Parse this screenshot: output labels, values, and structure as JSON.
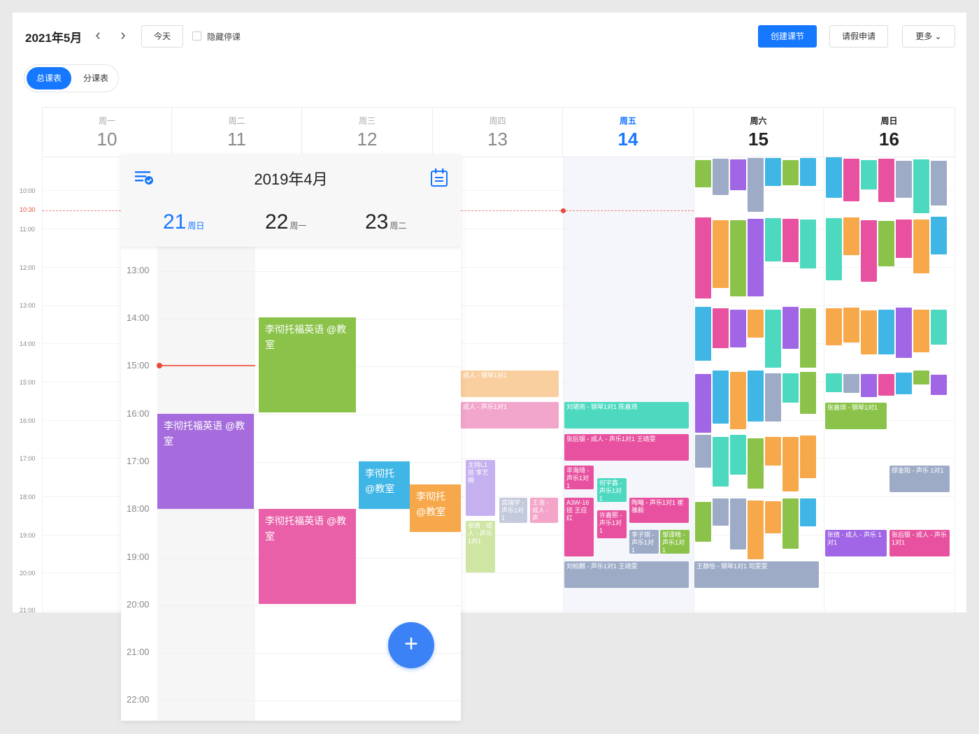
{
  "toolbar": {
    "month": "2021年5月",
    "prev": "‹",
    "next": "›",
    "today": "今天",
    "hide_suspended": "隐藏停课",
    "create": "创建课节",
    "leave": "请假申请",
    "more": "更多 ⌄"
  },
  "view_switch": {
    "total": "总课表",
    "split": "分课表"
  },
  "days": [
    {
      "weekday": "周一",
      "date": "10"
    },
    {
      "weekday": "周二",
      "date": "11"
    },
    {
      "weekday": "周三",
      "date": "12"
    },
    {
      "weekday": "周四",
      "date": "13"
    },
    {
      "weekday": "周五",
      "date": "14"
    },
    {
      "weekday": "周六",
      "date": "15"
    },
    {
      "weekday": "周日",
      "date": "16"
    }
  ],
  "time_labels": [
    "10:00",
    "10:30",
    "11:00",
    "12:00",
    "13:00",
    "14:00",
    "15:00",
    "16:00",
    "17:00",
    "18:00",
    "19:00",
    "20:00",
    "21:00"
  ],
  "events": {
    "thu_1": "成人 - 钢琴1对1",
    "thu_2": "成人 - 声乐1对1",
    "thu_3": "主持L1班 李艺楠",
    "thu_4": "张倩 - 成人 - 声乐1对1",
    "thu_5": "高瑞宇 - 声乐1对1",
    "thu_6": "王浩 - 成人 - 声",
    "fri_1": "刘珺雨 - 钢琴1对1 陈嘉琦",
    "fri_2": "张后银 - 成人 - 声乐1对1 王靖雯",
    "fri_3": "辛海琦 - 声乐1对1",
    "fri_4": "何宇鑫 - 声乐1对1",
    "fri_5": "A3W-16班 王应红",
    "fri_6": "许嘉熙 - 声乐1对1",
    "fri_7": "陶曦 - 声乐1对1 崔雅毅",
    "fri_8": "李子琪 - 声乐1对1",
    "fri_9": "邹译晴 - 声乐1对1",
    "fri_10": "刘柏麒 - 声乐1对1 王靖雯",
    "sat_1": "王静怡 - 钢琴1对1 司雯雯",
    "sun_1": "张倩 - 成人 - 声乐 1对1",
    "sun_2": "张后银 - 成人 - 声乐1对1",
    "sun_3": "张嘉琪 - 钢琴1对1",
    "sun_4": "缪金阳 - 声乐 1对1"
  },
  "mobile": {
    "title": "2019年4月",
    "days": [
      {
        "date": "21",
        "weekday": "周日"
      },
      {
        "date": "22",
        "weekday": "周一"
      },
      {
        "date": "23",
        "weekday": "周二"
      }
    ],
    "times": [
      "13:00",
      "14:00",
      "15:00",
      "16:00",
      "17:00",
      "18:00",
      "19:00",
      "20:00",
      "21:00",
      "22:00"
    ],
    "ev_green": "李彻托福英语 @教室",
    "ev_purple": "李彻托福英语 @教室",
    "ev_pink": "李彻托福英语 @教室",
    "ev_blue": "李彻托 @教室",
    "ev_orange": "李彻托 @教室",
    "fab": "+"
  },
  "colors": {
    "accent": "#1677ff",
    "green": "#8bc34a",
    "purple": "#a66bdc",
    "pink": "#e8519f",
    "cyan": "#3fb6e6",
    "orange": "#f7a84a",
    "teal": "#4dd9c0",
    "slate": "#9eabc7",
    "now": "#e64a3b"
  }
}
